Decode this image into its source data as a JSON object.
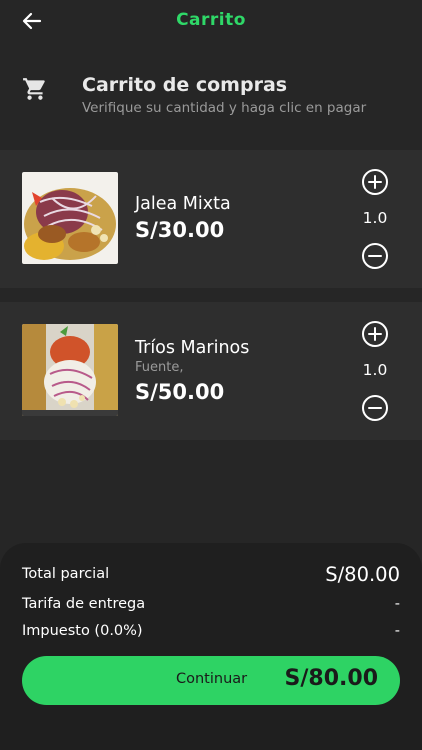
{
  "header": {
    "title": "Carrito"
  },
  "cart_header": {
    "title": "Carrito de compras",
    "subtitle": "Verifique su cantidad y haga clic en pagar"
  },
  "items": [
    {
      "name": "Jalea Mixta",
      "description": "",
      "price": "S/30.00",
      "quantity": "1.0"
    },
    {
      "name": "Tríos Marinos",
      "description": "Fuente,",
      "price": "S/50.00",
      "quantity": "1.0"
    }
  ],
  "summary": {
    "subtotal_label": "Total parcial",
    "subtotal_value": "S/80.00",
    "delivery_label": "Tarifa de entrega",
    "delivery_value": "-",
    "tax_label": "Impuesto (0.0%)",
    "tax_value": "-"
  },
  "cta": {
    "label": "Continuar",
    "total": "S/80.00"
  },
  "colors": {
    "accent": "#2fd868",
    "background": "#262626",
    "card": "#2e2e2e",
    "panel": "#1f1f1f"
  }
}
